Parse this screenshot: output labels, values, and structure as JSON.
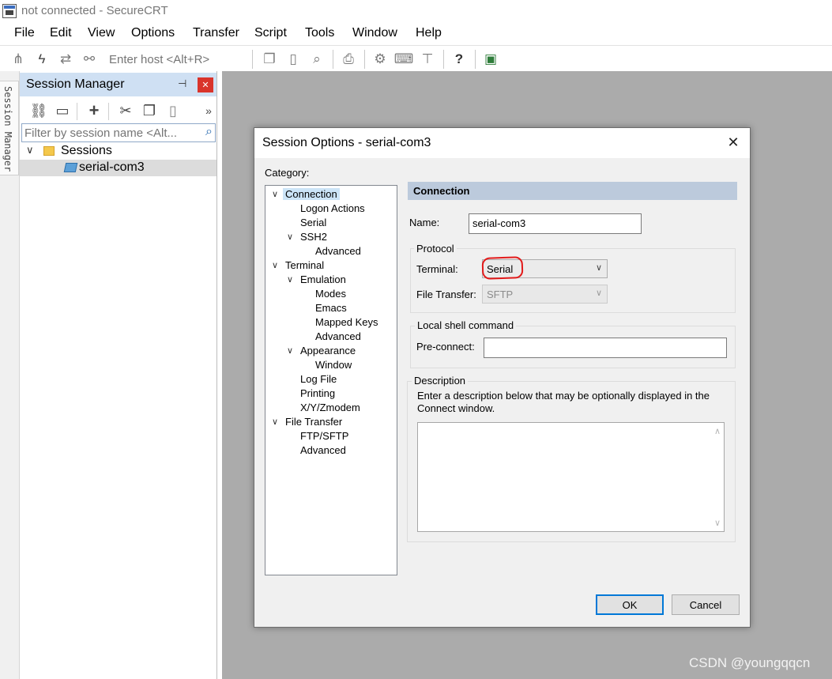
{
  "window": {
    "title": "not connected - SecureCRT"
  },
  "menu": [
    "File",
    "Edit",
    "View",
    "Options",
    "Transfer",
    "Script",
    "Tools",
    "Window",
    "Help"
  ],
  "toolbar": {
    "host_placeholder": "Enter host <Alt+R>",
    "icons": [
      "connect-bar-icon",
      "quick-connect-icon",
      "reconnect-icon",
      "disconnect-icon",
      "copy-icon",
      "paste-icon",
      "find-icon",
      "print-icon",
      "settings-icon",
      "keymap-icon",
      "sftp-icon",
      "help-icon",
      "sessions-icon"
    ]
  },
  "side_strip": {
    "tab_label": "Session Manager"
  },
  "session_manager": {
    "title": "Session Manager",
    "filter_placeholder": "Filter by session name <Alt...",
    "tree": [
      {
        "label": "Sessions",
        "type": "folder",
        "expanded": true
      },
      {
        "label": "serial-com3",
        "type": "session",
        "selected": true
      }
    ]
  },
  "dialog": {
    "title": "Session Options - serial-com3",
    "category_label": "Category:",
    "categories": [
      {
        "label": "Connection",
        "level": 0,
        "expanded": true,
        "selected": true
      },
      {
        "label": "Logon Actions",
        "level": 1
      },
      {
        "label": "Serial",
        "level": 1
      },
      {
        "label": "SSH2",
        "level": 1,
        "expanded": true
      },
      {
        "label": "Advanced",
        "level": 2
      },
      {
        "label": "Terminal",
        "level": 0,
        "expanded": true
      },
      {
        "label": "Emulation",
        "level": 1,
        "expanded": true
      },
      {
        "label": "Modes",
        "level": 2
      },
      {
        "label": "Emacs",
        "level": 2
      },
      {
        "label": "Mapped Keys",
        "level": 2
      },
      {
        "label": "Advanced",
        "level": 2
      },
      {
        "label": "Appearance",
        "level": 1,
        "expanded": true
      },
      {
        "label": "Window",
        "level": 2
      },
      {
        "label": "Log File",
        "level": 1
      },
      {
        "label": "Printing",
        "level": 1
      },
      {
        "label": "X/Y/Zmodem",
        "level": 1
      },
      {
        "label": "File Transfer",
        "level": 0,
        "expanded": true
      },
      {
        "label": "FTP/SFTP",
        "level": 1
      },
      {
        "label": "Advanced",
        "level": 1
      }
    ],
    "section_header": "Connection",
    "name_label": "Name:",
    "name_value": "serial-com3",
    "protocol": {
      "legend": "Protocol",
      "terminal_label": "Terminal:",
      "terminal_value": "Serial",
      "file_transfer_label": "File Transfer:",
      "file_transfer_value": "SFTP"
    },
    "local_shell": {
      "legend": "Local shell command",
      "preconnect_label": "Pre-connect:",
      "preconnect_value": ""
    },
    "description": {
      "legend": "Description",
      "hint_line1": "Enter a description below that may be optionally displayed in the",
      "hint_line2": "Connect window.",
      "value": ""
    },
    "ok_label": "OK",
    "cancel_label": "Cancel"
  },
  "watermark": "CSDN @youngqqcn",
  "colors": {
    "session_header_bg": "#cfe0f3",
    "workspace_bg": "#ababab",
    "connection_header_bg": "#bccadc",
    "annotation_red": "#e21a1a",
    "default_button_border": "#0078d7"
  }
}
